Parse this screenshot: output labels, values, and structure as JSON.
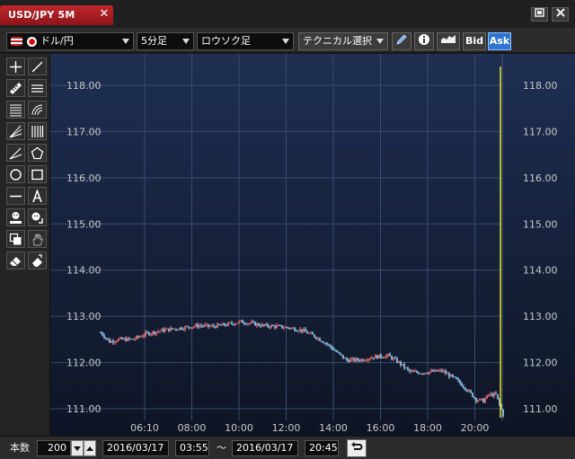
{
  "window": {
    "tab_title": "USD/JPY 5M",
    "close_glyph": "✕"
  },
  "toolbar": {
    "pair": "ドル/円",
    "interval": "5分足",
    "chart_type": "ロウソク足",
    "technical": "テクニカル選択",
    "bid_label": "Bid",
    "ask_label": "Ask",
    "ask_active": true
  },
  "tools": [
    {
      "name": "crosshair-tool-icon"
    },
    {
      "name": "trendline-tool-icon"
    },
    {
      "name": "ruler-tool-icon"
    },
    {
      "name": "horizontal-lines-tool-icon"
    },
    {
      "name": "fibonacci-retracement-icon"
    },
    {
      "name": "fibonacci-arc-icon"
    },
    {
      "name": "fan-lines-tool-icon"
    },
    {
      "name": "fibonacci-timezone-icon"
    },
    {
      "name": "angle-line-tool-icon"
    },
    {
      "name": "pentagon-tool-icon"
    },
    {
      "name": "circle-tool-icon"
    },
    {
      "name": "rectangle-tool-icon"
    },
    {
      "name": "horizontal-line-tool-icon"
    },
    {
      "name": "text-tool-icon"
    },
    {
      "name": "icon-stamp-tool-icon"
    },
    {
      "name": "icon-select-tool-icon"
    },
    {
      "name": "copy-tool-icon"
    },
    {
      "name": "hand-tool-icon"
    },
    {
      "name": "eraser-tool-icon"
    },
    {
      "name": "eraser-all-tool-icon"
    }
  ],
  "chart_data": {
    "type": "candlestick",
    "title": "",
    "xlabel": "",
    "ylabel": "",
    "ylim": [
      110.7,
      118.4
    ],
    "y_ticks": [
      "118.00",
      "117.00",
      "116.00",
      "115.00",
      "114.00",
      "113.00",
      "112.00",
      "111.00"
    ],
    "x_ticks": [
      "06:10",
      "08:00",
      "10:00",
      "12:00",
      "14:00",
      "16:00",
      "18:00",
      "20:00"
    ],
    "grid": true,
    "up_color": "#ff7777",
    "down_color": "#9ad8ff",
    "current_line_color": "#e0e020",
    "path": [
      [
        0,
        112.65
      ],
      [
        5,
        112.45
      ],
      [
        10,
        112.5
      ],
      [
        18,
        112.5
      ],
      [
        25,
        112.62
      ],
      [
        35,
        112.7
      ],
      [
        45,
        112.75
      ],
      [
        55,
        112.8
      ],
      [
        62,
        112.78
      ],
      [
        70,
        112.82
      ],
      [
        78,
        112.88
      ],
      [
        84,
        112.85
      ],
      [
        90,
        112.8
      ],
      [
        98,
        112.78
      ],
      [
        105,
        112.75
      ],
      [
        112,
        112.7
      ],
      [
        120,
        112.55
      ],
      [
        126,
        112.4
      ],
      [
        132,
        112.2
      ],
      [
        137,
        112.05
      ],
      [
        145,
        112.06
      ],
      [
        152,
        112.12
      ],
      [
        160,
        112.15
      ],
      [
        166,
        112.0
      ],
      [
        172,
        111.8
      ],
      [
        178,
        111.78
      ],
      [
        184,
        111.8
      ],
      [
        190,
        111.82
      ],
      [
        197,
        111.65
      ],
      [
        203,
        111.45
      ],
      [
        209,
        111.2
      ],
      [
        213,
        111.17
      ],
      [
        216,
        111.3
      ],
      [
        220,
        111.3
      ],
      [
        224,
        110.87
      ]
    ]
  },
  "bottom": {
    "count_label": "本数",
    "count_value": "200",
    "start_date": "2016/03/17",
    "start_time": "03:55",
    "range_sep": "〜",
    "end_date": "2016/03/17",
    "end_time": "20:45"
  }
}
